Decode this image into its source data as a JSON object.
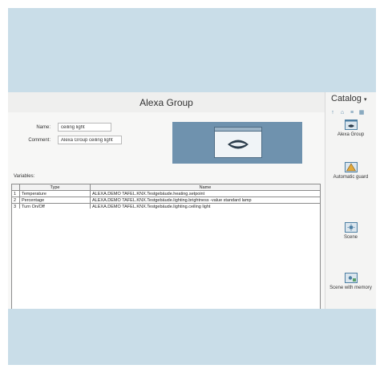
{
  "editor": {
    "title": "Alexa Group",
    "name_label": "Name:",
    "name_value": "ceiling light",
    "comment_label": "Comment:",
    "comment_value": "Alexa Group ceiling light",
    "variables_label": "Variables:",
    "table": {
      "headers": [
        "",
        "Type",
        "Name"
      ],
      "rows": [
        {
          "index": "1",
          "type": "Temperature",
          "name": "ALEXA.DEMO TAFEL.KNX.Testgebäude.heating.setpoint"
        },
        {
          "index": "2",
          "type": "Percentage",
          "name": "ALEXA.DEMO TAFEL.KNX.Testgebäude.lighting.brightness -value standard lamp"
        },
        {
          "index": "3",
          "type": "Turn On/Off",
          "name": "ALEXA.DEMO TAFEL.KNX.Testgebäude.lighting.ceiling light"
        }
      ]
    }
  },
  "catalog": {
    "title": "Catalog",
    "items": [
      {
        "label": "Alexa Group",
        "icon": "alexa-group-icon"
      },
      {
        "label": "Automatic guard",
        "icon": "warning-triangle-icon"
      },
      {
        "label": "Scene",
        "icon": "scene-icon"
      },
      {
        "label": "Scene with memory",
        "icon": "scene-memory-icon"
      }
    ]
  },
  "colors": {
    "background": "#c9dde8",
    "preview": "#6f92ae",
    "accent": "#4d7fa3"
  }
}
